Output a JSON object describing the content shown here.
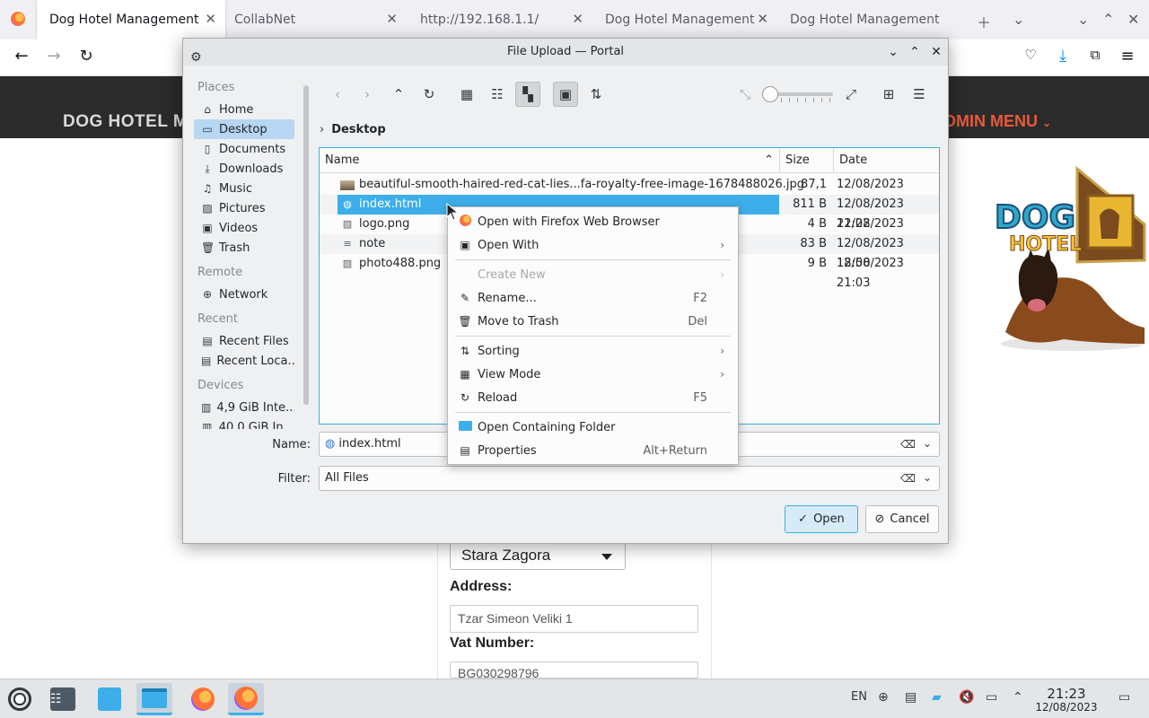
{
  "browser": {
    "tabs": [
      {
        "label": "Dog Hotel Management",
        "active": true
      },
      {
        "label": "CollabNet",
        "active": false
      },
      {
        "label": "http://192.168.1.1/",
        "active": false
      },
      {
        "label": "Dog Hotel Management",
        "active": false
      },
      {
        "label": "Dog Hotel Management",
        "active": false
      }
    ]
  },
  "site": {
    "brand": "DOG HOTEL M",
    "admin_menu": "DMIN MENU",
    "city_select": "Stara Zagora",
    "address_label": "Address:",
    "address_value": "Tzar Simeon Veliki 1",
    "vat_label": "Vat Number:",
    "vat_value": "BG030298796",
    "logo_text_1": "DOG",
    "logo_text_2": "HOTEL"
  },
  "dialog": {
    "title": "File Upload — Portal",
    "places": {
      "head_places": "Places",
      "head_remote": "Remote",
      "head_recent": "Recent",
      "head_devices": "Devices",
      "items": [
        {
          "label": "Home",
          "icon": "home-icon"
        },
        {
          "label": "Desktop",
          "icon": "desktop-icon"
        },
        {
          "label": "Documents",
          "icon": "documents-icon"
        },
        {
          "label": "Downloads",
          "icon": "downloads-icon"
        },
        {
          "label": "Music",
          "icon": "music-icon"
        },
        {
          "label": "Pictures",
          "icon": "pictures-icon"
        },
        {
          "label": "Videos",
          "icon": "videos-icon"
        },
        {
          "label": "Trash",
          "icon": "trash-icon"
        }
      ],
      "remote": [
        {
          "label": "Network",
          "icon": "network-icon"
        }
      ],
      "recent": [
        {
          "label": "Recent Files",
          "icon": "recent-files-icon"
        },
        {
          "label": "Recent Loca...",
          "icon": "recent-locations-icon"
        }
      ],
      "devices": [
        {
          "label": "4,9 GiB Inte...",
          "icon": "drive-icon"
        },
        {
          "label": "40,0 GiB In...",
          "icon": "drive-icon"
        }
      ]
    },
    "breadcrumb": "Desktop",
    "columns": {
      "name": "Name",
      "size": "Size",
      "date": "Date"
    },
    "files": [
      {
        "name": "beautiful-smooth-haired-red-cat-lies...fa-royalty-free-image-1678488026.jpg",
        "size": "87,1 KiB",
        "date": "12/08/2023 21:05",
        "icon": "image-thumbnail-icon"
      },
      {
        "name": "index.html",
        "size": "811 B",
        "date": "12/08/2023 21:22",
        "icon": "html-file-icon"
      },
      {
        "name": "logo.png",
        "size": "4 B",
        "date": "12/08/2023 21:19",
        "icon": "image-file-icon"
      },
      {
        "name": "note",
        "size": "83 B",
        "date": "12/08/2023 18:50",
        "icon": "text-file-icon"
      },
      {
        "name": "photo488.png",
        "size": "9 B",
        "date": "12/08/2023 21:03",
        "icon": "image-file-icon"
      }
    ],
    "name_label": "Name:",
    "name_value": "index.html",
    "filter_label": "Filter:",
    "filter_value": "All Files",
    "open_button": "Open",
    "cancel_button": "Cancel"
  },
  "context_menu": {
    "items": [
      {
        "label": "Open with Firefox Web Browser",
        "shortcut": "",
        "icon": "firefox-icon"
      },
      {
        "label": "Open With",
        "shortcut": "",
        "icon": "open-with-icon",
        "submenu": true
      },
      {
        "label": "Create New",
        "shortcut": "",
        "icon": "",
        "submenu": true,
        "disabled": true
      },
      {
        "label": "Rename...",
        "shortcut": "F2",
        "icon": "rename-icon"
      },
      {
        "label": "Move to Trash",
        "shortcut": "Del",
        "icon": "trash-icon"
      },
      {
        "label": "Sorting",
        "shortcut": "",
        "icon": "sorting-icon",
        "submenu": true
      },
      {
        "label": "View Mode",
        "shortcut": "",
        "icon": "view-mode-icon",
        "submenu": true
      },
      {
        "label": "Reload",
        "shortcut": "F5",
        "icon": "reload-icon"
      },
      {
        "label": "Open Containing Folder",
        "shortcut": "",
        "icon": "folder-icon"
      },
      {
        "label": "Properties",
        "shortcut": "Alt+Return",
        "icon": "properties-icon"
      }
    ]
  },
  "taskbar": {
    "language": "EN",
    "time": "21:23",
    "date": "12/08/2023"
  }
}
